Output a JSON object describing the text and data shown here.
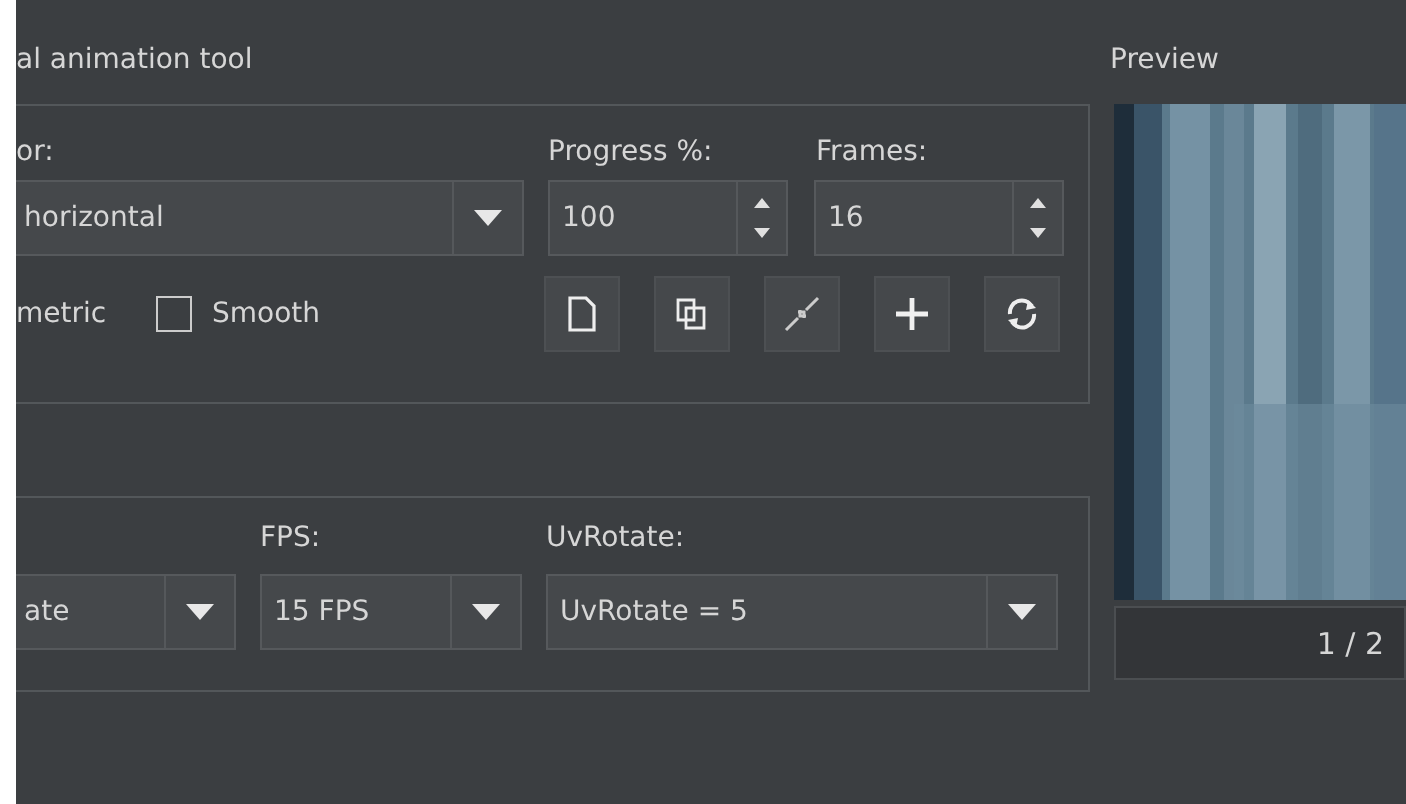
{
  "panel": {
    "title": "al animation tool"
  },
  "animation_group": {
    "mode_label": "or:",
    "mode_value": "horizontal",
    "progress": {
      "label": "Progress %:",
      "value": "100"
    },
    "frames": {
      "label": "Frames:",
      "value": "16"
    },
    "cut_label": "metric",
    "checkboxes": [
      {
        "label": "Smooth",
        "checked": false
      }
    ],
    "tool_buttons": [
      {
        "kind": "page"
      },
      {
        "kind": "copy"
      },
      {
        "kind": "shrink"
      },
      {
        "kind": "add"
      },
      {
        "kind": "refresh"
      }
    ]
  },
  "playback_group": {
    "combos": [
      {
        "value": "ate"
      },
      {
        "label": "FPS:",
        "value": "15 FPS"
      },
      {
        "label": "UvRotate:",
        "value": "UvRotate = 5"
      }
    ]
  },
  "preview": {
    "label": "Preview",
    "counter": "1 / 2"
  }
}
